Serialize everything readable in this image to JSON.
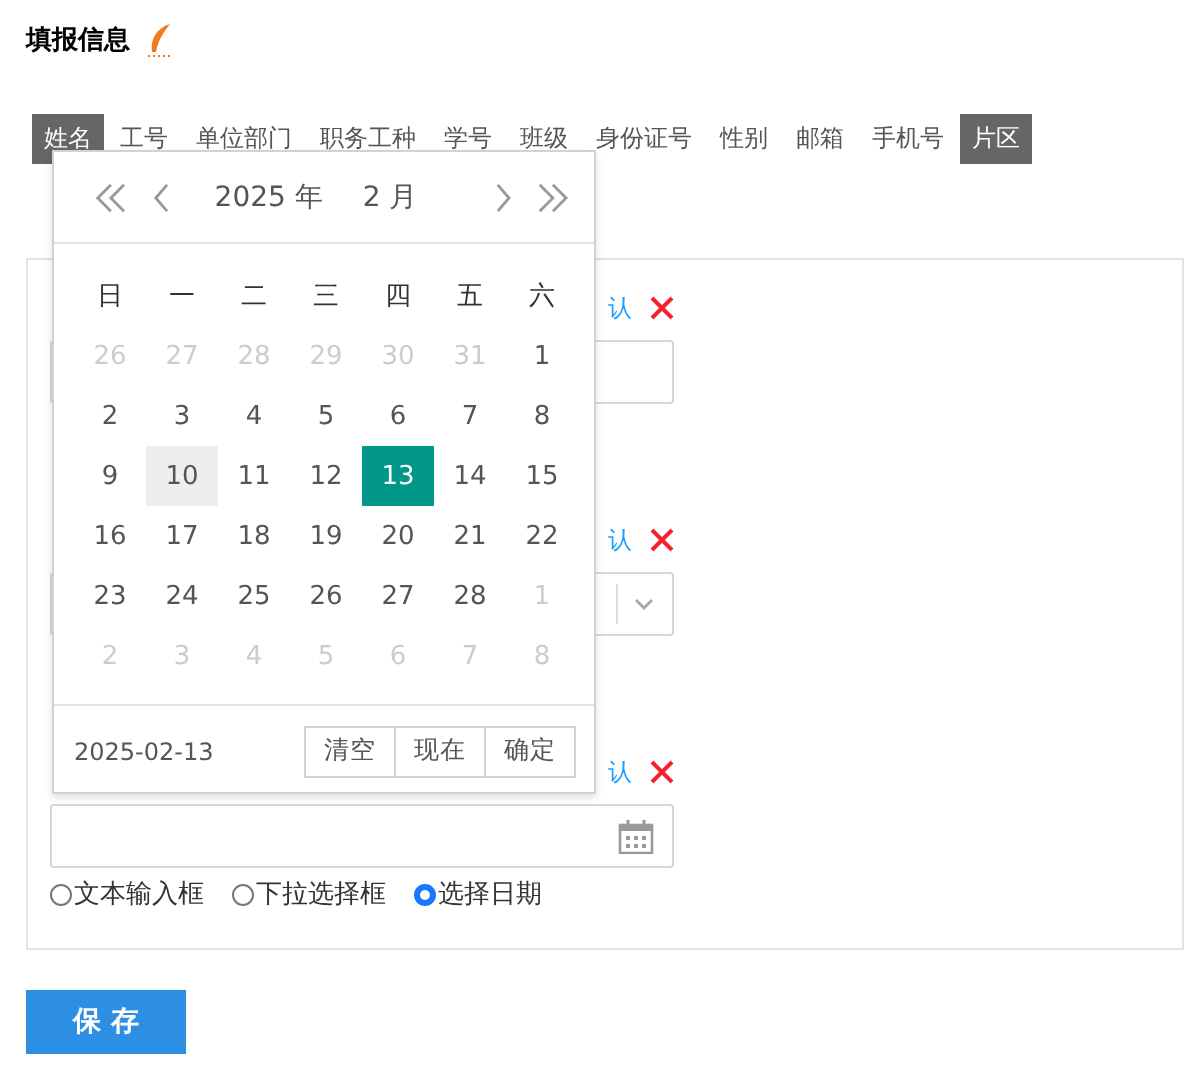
{
  "title": "填报信息",
  "tags": [
    {
      "label": "姓名",
      "selected": true
    },
    {
      "label": "工号",
      "selected": false
    },
    {
      "label": "单位部门",
      "selected": false
    },
    {
      "label": "职务工种",
      "selected": false
    },
    {
      "label": "学号",
      "selected": false
    },
    {
      "label": "班级",
      "selected": false
    },
    {
      "label": "身份证号",
      "selected": false
    },
    {
      "label": "性别",
      "selected": false
    },
    {
      "label": "邮箱",
      "selected": false
    },
    {
      "label": "手机号",
      "selected": false
    },
    {
      "label": "片区",
      "selected": true
    }
  ],
  "fields": [
    {
      "kind": "text",
      "default_link": "认"
    },
    {
      "kind": "select",
      "default_link": "认"
    },
    {
      "kind": "date",
      "default_link": "认"
    }
  ],
  "field_types": [
    {
      "label": "文本输入框",
      "selected": false
    },
    {
      "label": "下拉选择框",
      "selected": false
    },
    {
      "label": "选择日期",
      "selected": true
    }
  ],
  "date_picker": {
    "year": "2025 年",
    "month": "2 月",
    "weekdays": [
      "日",
      "一",
      "二",
      "三",
      "四",
      "五",
      "六"
    ],
    "days": [
      {
        "text": "26",
        "muted": true,
        "hover": false,
        "selected": false
      },
      {
        "text": "27",
        "muted": true,
        "hover": false,
        "selected": false
      },
      {
        "text": "28",
        "muted": true,
        "hover": false,
        "selected": false
      },
      {
        "text": "29",
        "muted": true,
        "hover": false,
        "selected": false
      },
      {
        "text": "30",
        "muted": true,
        "hover": false,
        "selected": false
      },
      {
        "text": "31",
        "muted": true,
        "hover": false,
        "selected": false
      },
      {
        "text": "1",
        "muted": false,
        "hover": false,
        "selected": false
      },
      {
        "text": "2",
        "muted": false,
        "hover": false,
        "selected": false
      },
      {
        "text": "3",
        "muted": false,
        "hover": false,
        "selected": false
      },
      {
        "text": "4",
        "muted": false,
        "hover": false,
        "selected": false
      },
      {
        "text": "5",
        "muted": false,
        "hover": false,
        "selected": false
      },
      {
        "text": "6",
        "muted": false,
        "hover": false,
        "selected": false
      },
      {
        "text": "7",
        "muted": false,
        "hover": false,
        "selected": false
      },
      {
        "text": "8",
        "muted": false,
        "hover": false,
        "selected": false
      },
      {
        "text": "9",
        "muted": false,
        "hover": false,
        "selected": false
      },
      {
        "text": "10",
        "muted": false,
        "hover": true,
        "selected": false
      },
      {
        "text": "11",
        "muted": false,
        "hover": false,
        "selected": false
      },
      {
        "text": "12",
        "muted": false,
        "hover": false,
        "selected": false
      },
      {
        "text": "13",
        "muted": false,
        "hover": false,
        "selected": true
      },
      {
        "text": "14",
        "muted": false,
        "hover": false,
        "selected": false
      },
      {
        "text": "15",
        "muted": false,
        "hover": false,
        "selected": false
      },
      {
        "text": "16",
        "muted": false,
        "hover": false,
        "selected": false
      },
      {
        "text": "17",
        "muted": false,
        "hover": false,
        "selected": false
      },
      {
        "text": "18",
        "muted": false,
        "hover": false,
        "selected": false
      },
      {
        "text": "19",
        "muted": false,
        "hover": false,
        "selected": false
      },
      {
        "text": "20",
        "muted": false,
        "hover": false,
        "selected": false
      },
      {
        "text": "21",
        "muted": false,
        "hover": false,
        "selected": false
      },
      {
        "text": "22",
        "muted": false,
        "hover": false,
        "selected": false
      },
      {
        "text": "23",
        "muted": false,
        "hover": false,
        "selected": false
      },
      {
        "text": "24",
        "muted": false,
        "hover": false,
        "selected": false
      },
      {
        "text": "25",
        "muted": false,
        "hover": false,
        "selected": false
      },
      {
        "text": "26",
        "muted": false,
        "hover": false,
        "selected": false
      },
      {
        "text": "27",
        "muted": false,
        "hover": false,
        "selected": false
      },
      {
        "text": "28",
        "muted": false,
        "hover": false,
        "selected": false
      },
      {
        "text": "1",
        "muted": true,
        "hover": false,
        "selected": false
      },
      {
        "text": "2",
        "muted": true,
        "hover": false,
        "selected": false
      },
      {
        "text": "3",
        "muted": true,
        "hover": false,
        "selected": false
      },
      {
        "text": "4",
        "muted": true,
        "hover": false,
        "selected": false
      },
      {
        "text": "5",
        "muted": true,
        "hover": false,
        "selected": false
      },
      {
        "text": "6",
        "muted": true,
        "hover": false,
        "selected": false
      },
      {
        "text": "7",
        "muted": true,
        "hover": false,
        "selected": false
      },
      {
        "text": "8",
        "muted": true,
        "hover": false,
        "selected": false
      }
    ],
    "value": "2025-02-13",
    "buttons": [
      "清空",
      "现在",
      "确定"
    ]
  },
  "save_button": "保 存"
}
